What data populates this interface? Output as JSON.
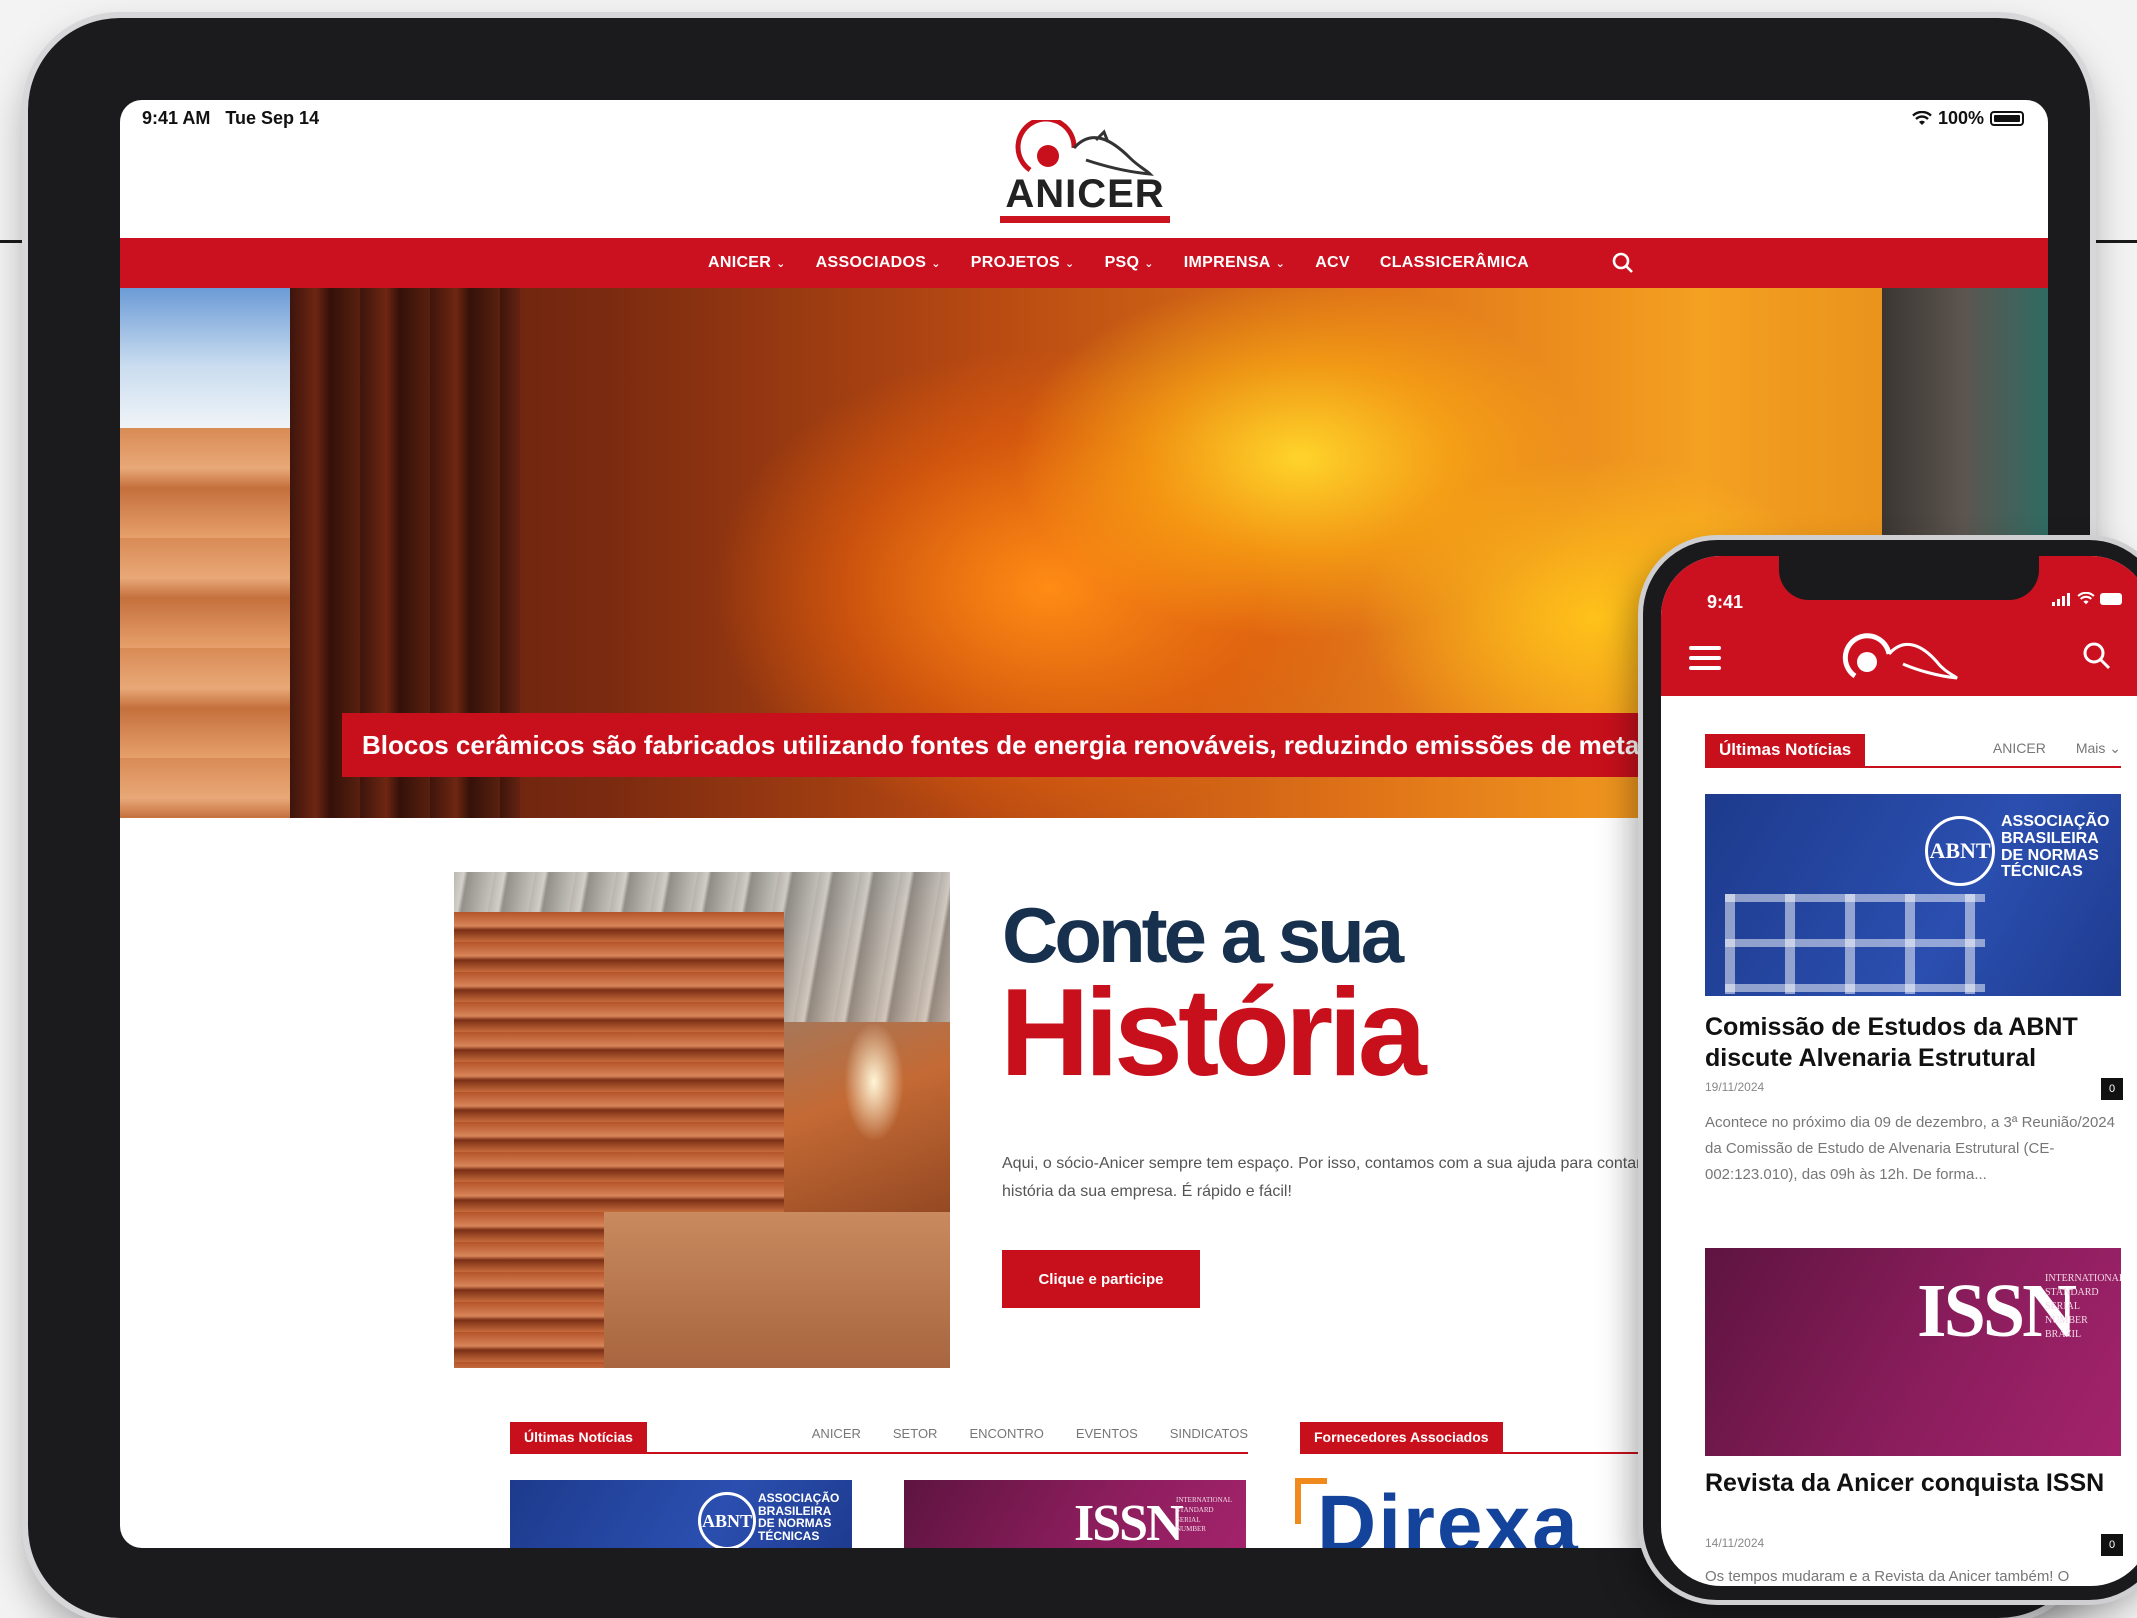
{
  "tablet": {
    "status": {
      "time": "9:41 AM",
      "date": "Tue Sep 14",
      "battery": "100%"
    },
    "logo": {
      "text": "ANICER",
      "icon": "anicer-bird-logo"
    },
    "nav": {
      "items": [
        {
          "label": "ANICER",
          "dropdown": true
        },
        {
          "label": "ASSOCIADOS",
          "dropdown": true
        },
        {
          "label": "PROJETOS",
          "dropdown": true
        },
        {
          "label": "PSQ",
          "dropdown": true
        },
        {
          "label": "IMPRENSA",
          "dropdown": true
        },
        {
          "label": "ACV",
          "dropdown": false
        },
        {
          "label": "CLASSICERÂMICA",
          "dropdown": false
        }
      ],
      "search_icon": "search-icon"
    },
    "hero": {
      "caption": "Blocos cerâmicos são fabricados utilizando fontes de energia renováveis, reduzindo emissões de metano"
    },
    "story": {
      "title_line1": "Conte a sua",
      "title_line2": "História",
      "text": "Aqui, o sócio-Anicer sempre tem espaço. Por isso, contamos com a sua ajuda para contar a história da sua empresa. É rápido e fácil!",
      "button": "Clique e participe"
    },
    "news": {
      "tag": "Últimas Notícias",
      "tabs": [
        "ANICER",
        "SETOR",
        "ENCONTRO",
        "EVENTOS",
        "SINDICATOS"
      ],
      "abnt_card": {
        "logo": "ABNT",
        "words": [
          "ASSOCIAÇÃO",
          "BRASILEIRA",
          "DE NORMAS",
          "TÉCNICAS"
        ]
      },
      "issn_card": {
        "word": "ISSN",
        "words": [
          "INTERNATIONAL",
          "STANDARD",
          "SERIAL",
          "NUMBER"
        ]
      }
    },
    "suppliers": {
      "tag": "Fornecedores Associados",
      "partner": "Direxa"
    }
  },
  "phone": {
    "status": {
      "time": "9:41"
    },
    "section": {
      "tag": "Últimas Notícias",
      "tabs": [
        "ANICER",
        "Mais"
      ]
    },
    "articles": [
      {
        "title": "Comissão de Estudos da ABNT discute Alvenaria Estrutural",
        "date": "19/11/2024",
        "comments": "0",
        "excerpt": "Acontece no próximo dia 09 de dezembro, a 3ª Reunião/2024 da Comissão de Estudo de Alvenaria Estrutural (CE-002:123.010), das 09h às 12h. De forma...",
        "image": {
          "logo": "ABNT",
          "words": [
            "ASSOCIAÇÃO",
            "BRASILEIRA",
            "DE NORMAS",
            "TÉCNICAS"
          ]
        }
      },
      {
        "title": "Revista da Anicer conquista ISSN",
        "date": "14/11/2024",
        "comments": "0",
        "excerpt": "Os tempos mudaram e a Revista da Anicer também! O",
        "image": {
          "word": "ISSN",
          "words": [
            "INTERNATIONAL",
            "STANDARD",
            "SERIAL",
            "NUMBER",
            "BRAZIL"
          ]
        }
      }
    ]
  },
  "colors": {
    "brand_red": "#cb1120",
    "navy": "#17304d",
    "abnt_blue": "#1d3a8c",
    "issn_magenta": "#8a1d5c"
  }
}
